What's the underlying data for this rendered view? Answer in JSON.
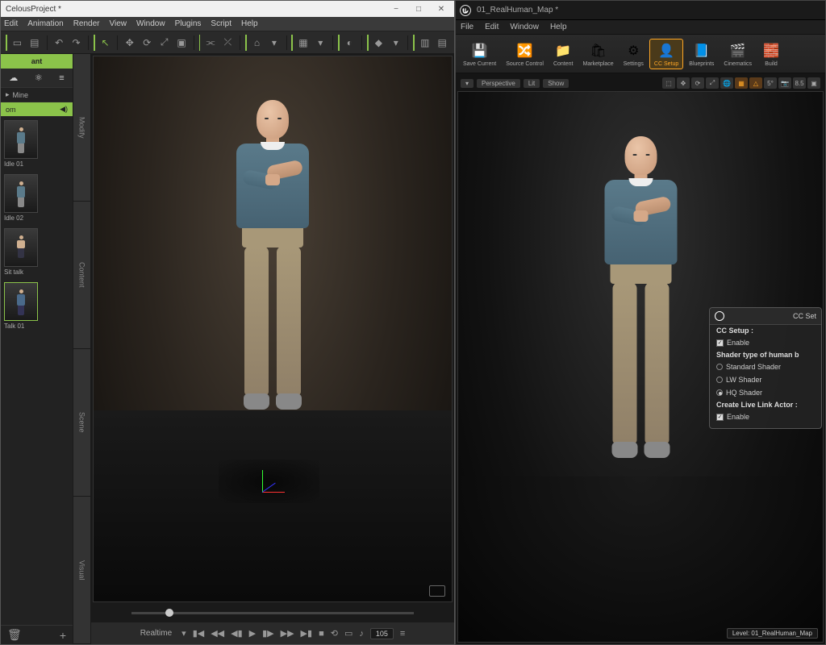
{
  "left": {
    "title": "CelousProject *",
    "menu": [
      "Edit",
      "Animation",
      "Render",
      "View",
      "Window",
      "Plugins",
      "Script",
      "Help"
    ],
    "sidebar": {
      "header": "ant",
      "row1": "Mine",
      "row2": "om",
      "thumbs": [
        {
          "label": "Idle 01"
        },
        {
          "label": "Idle 02"
        },
        {
          "label": "Sit talk"
        },
        {
          "label": "Talk 01"
        }
      ]
    },
    "vtabs": [
      "Modify",
      "Content",
      "Scene",
      "Visual"
    ],
    "playback": {
      "mode": "Realtime",
      "frame": "105"
    }
  },
  "right": {
    "title": "01_RealHuman_Map *",
    "menu": [
      "File",
      "Edit",
      "Window",
      "Help"
    ],
    "toolbar": [
      {
        "label": "Save Current",
        "icon": "💾"
      },
      {
        "label": "Source Control",
        "icon": "🔀"
      },
      {
        "label": "Content",
        "icon": "📁"
      },
      {
        "label": "Marketplace",
        "icon": "🛍"
      },
      {
        "label": "Settings",
        "icon": "⚙"
      },
      {
        "label": "CC Setup",
        "icon": "👤",
        "highlight": true
      },
      {
        "label": "Blueprints",
        "icon": "📘"
      },
      {
        "label": "Cinematics",
        "icon": "🎬"
      },
      {
        "label": "Build",
        "icon": "🧱"
      }
    ],
    "viewport_bar": {
      "perspective": "Perspective",
      "lit": "Lit",
      "show": "Show",
      "angle": "5°",
      "speed": "8.5"
    },
    "cc_panel": {
      "title": "CC Set",
      "setup_label": "CC Setup :",
      "enable": "Enable",
      "shader_label": "Shader type of human b",
      "shader_options": [
        "Standard Shader",
        "LW Shader",
        "HQ Shader"
      ],
      "livelink_label": "Create Live Link Actor :"
    },
    "status": "Level: 01_RealHuman_Map"
  }
}
